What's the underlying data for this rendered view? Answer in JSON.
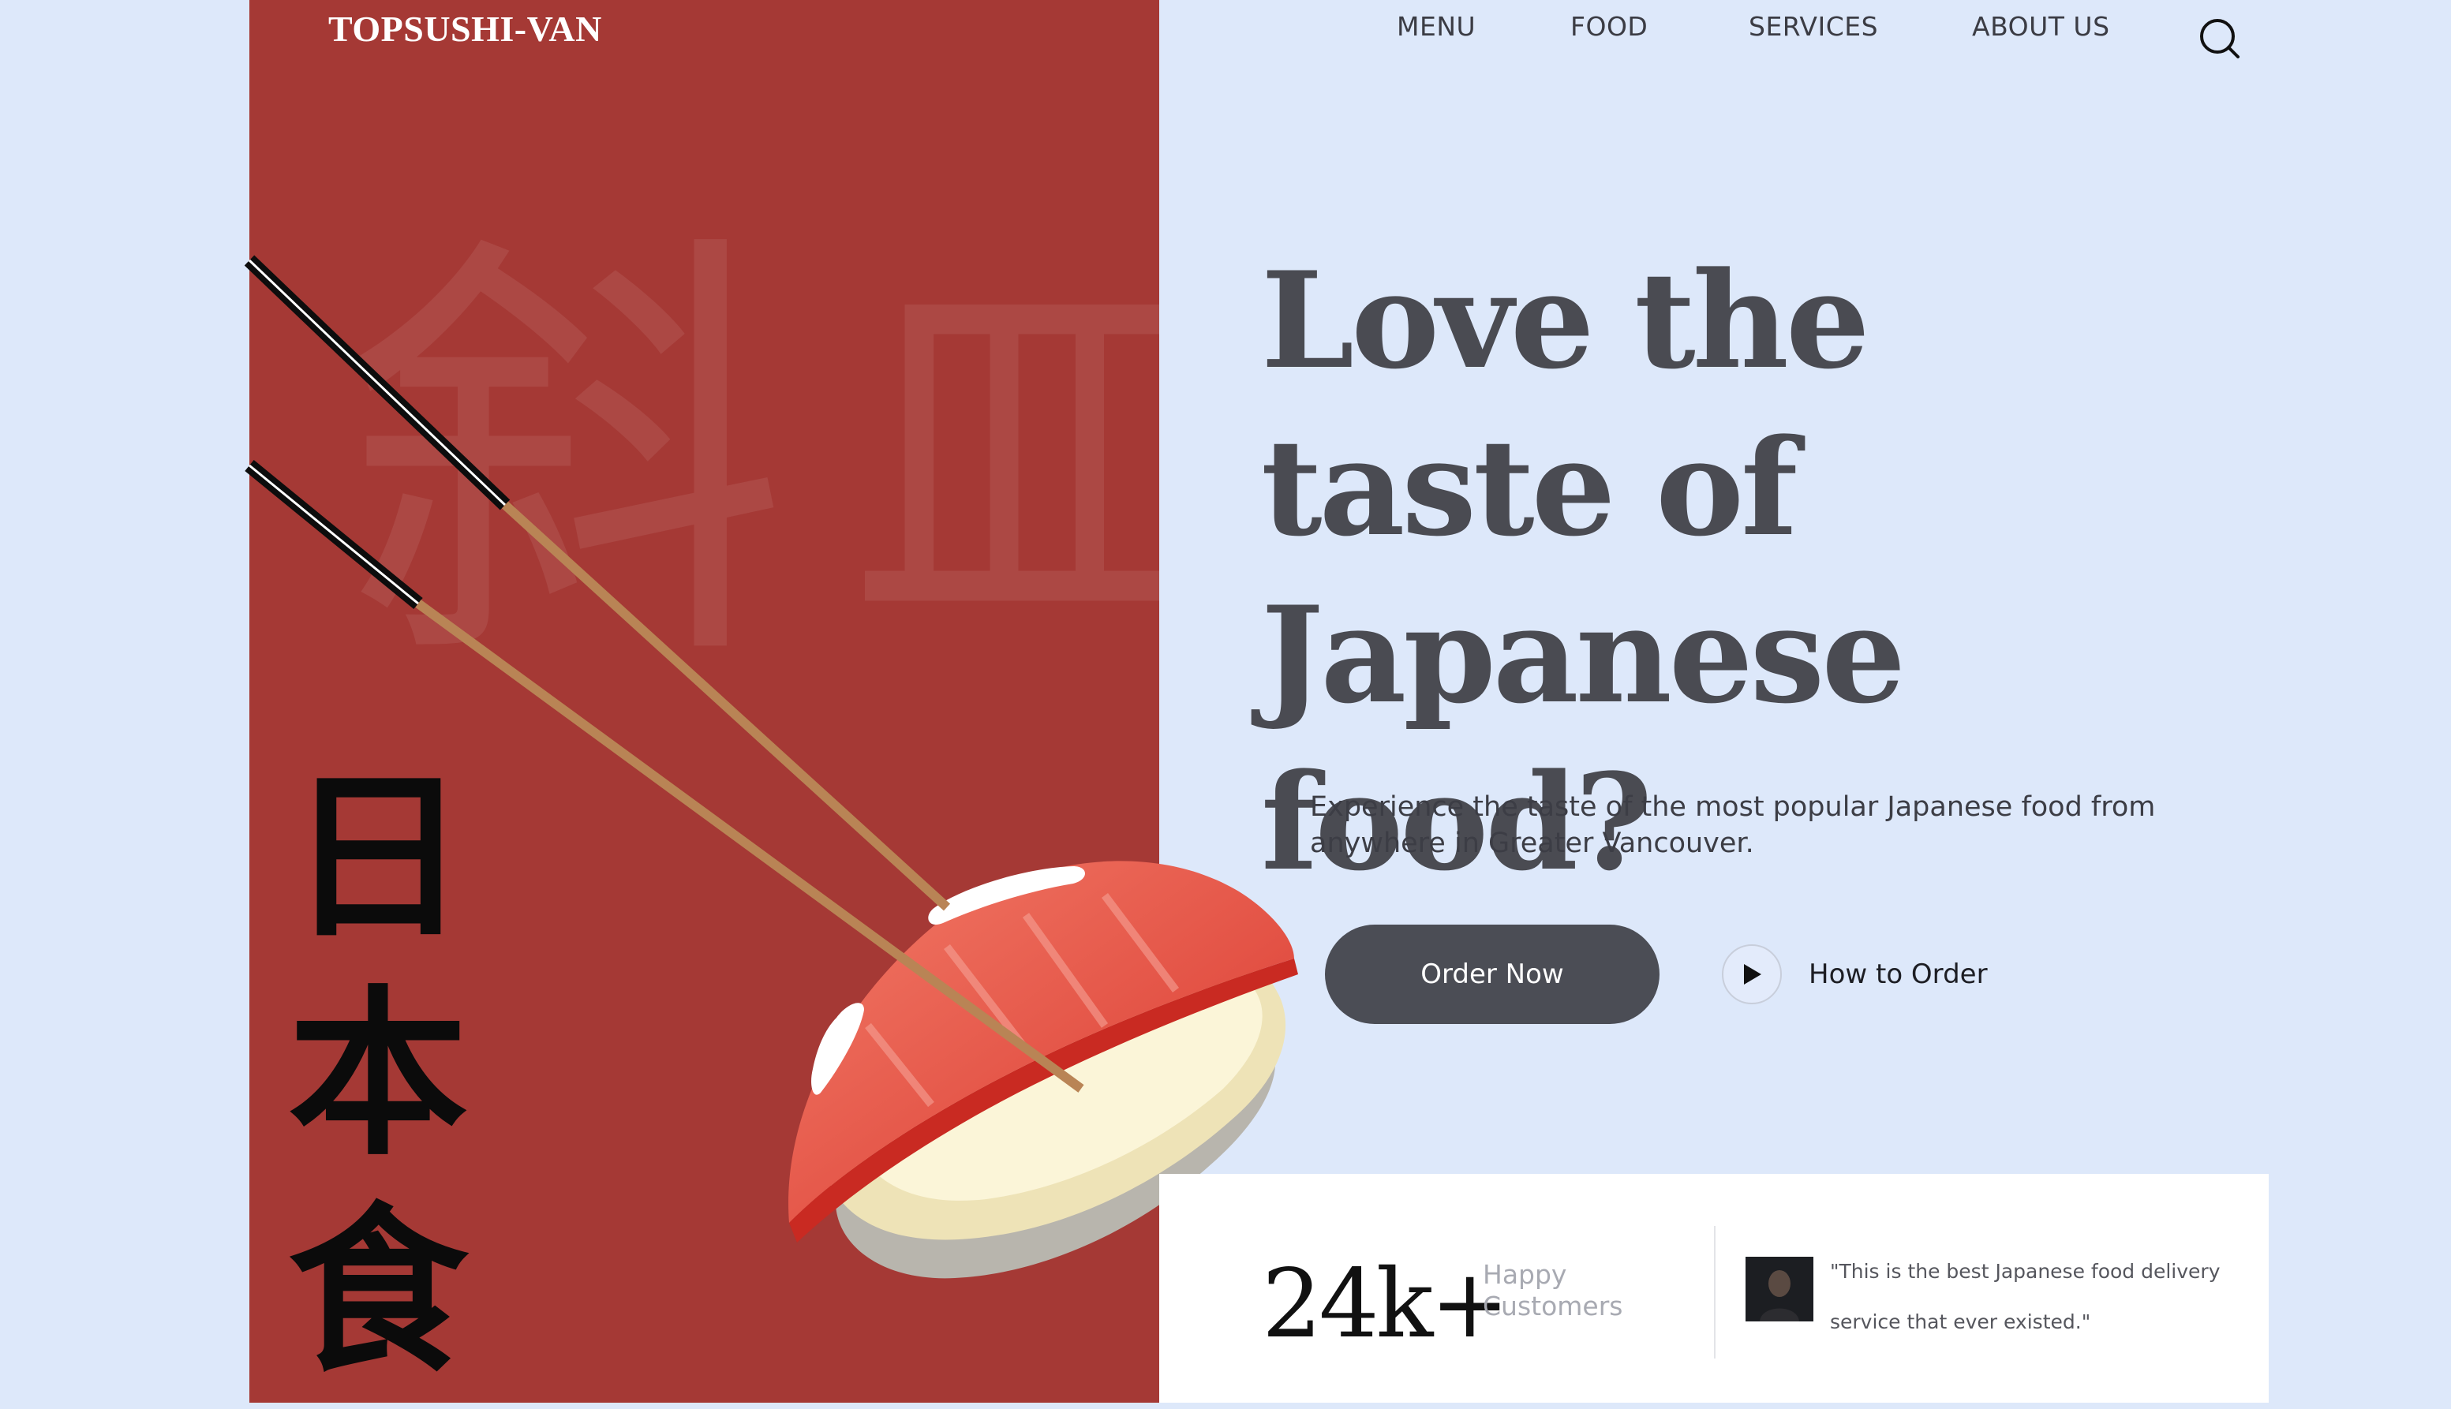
{
  "brand": {
    "logo": "TOPSUSHI-VAN"
  },
  "nav": {
    "items": [
      "MENU",
      "FOOD",
      "SERVICES",
      "ABOUT US"
    ],
    "search_icon": "search-icon"
  },
  "hero": {
    "title": "Love the taste of Japanese food?",
    "subtitle": "Experience the taste of the most popular Japanese food from anywhere in Greater Vancouver.",
    "order_button": "Order Now",
    "how_to_label": "How to Order",
    "play_icon": "play-icon"
  },
  "decor": {
    "vertical_text": [
      "日",
      "本",
      "食"
    ],
    "background_kanji": [
      "斜",
      "皿"
    ]
  },
  "stats": {
    "count": "24k+",
    "label": "Happy Customers",
    "quote": "\"This is the best Japanese food delivery service that ever existed.\""
  },
  "colors": {
    "background": "#dde8fa",
    "panel_red": "#a53935",
    "title_gray": "#4a4b52",
    "button_dark": "#4b4d55"
  }
}
